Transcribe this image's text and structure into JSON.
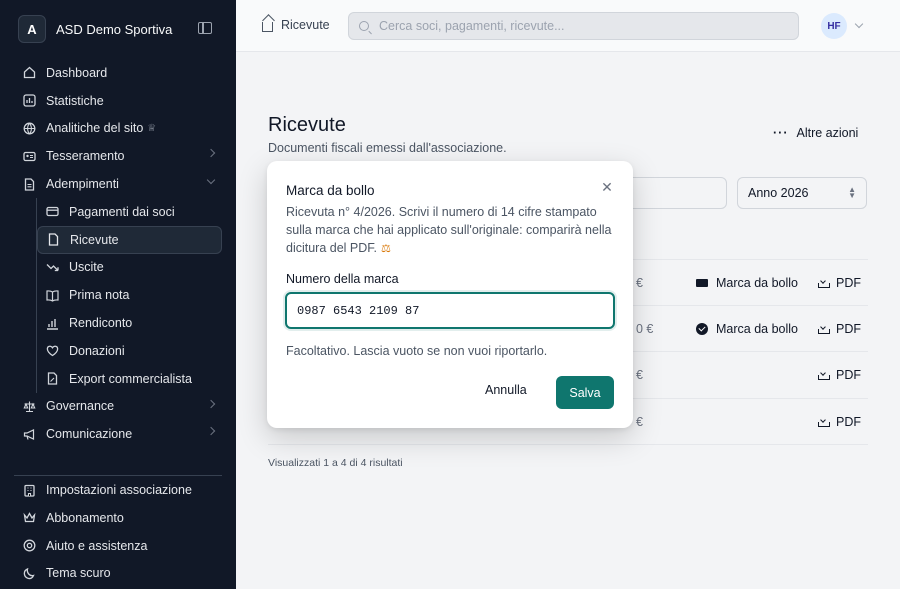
{
  "sidebar": {
    "org_initial": "A",
    "org_name": "ASD Demo Sportiva",
    "items": [
      {
        "label": "Dashboard"
      },
      {
        "label": "Statistiche"
      },
      {
        "label": "Analitiche del sito"
      },
      {
        "label": "Tesseramento"
      },
      {
        "label": "Adempimenti"
      }
    ],
    "sub_items": [
      {
        "label": "Pagamenti dai soci"
      },
      {
        "label": "Ricevute"
      },
      {
        "label": "Uscite"
      },
      {
        "label": "Prima nota"
      },
      {
        "label": "Rendiconto"
      },
      {
        "label": "Donazioni"
      },
      {
        "label": "Export commercialista"
      }
    ],
    "after_items": [
      {
        "label": "Governance"
      },
      {
        "label": "Comunicazione"
      }
    ],
    "bottom_items": [
      {
        "label": "Impostazioni associazione"
      },
      {
        "label": "Abbonamento"
      },
      {
        "label": "Aiuto e assistenza"
      },
      {
        "label": "Tema scuro"
      }
    ]
  },
  "topbar": {
    "breadcrumb": "Ricevute",
    "search_placeholder": "Cerca soci, pagamenti, ricevute...",
    "user_initials": "HF"
  },
  "main": {
    "title": "Ricevute",
    "subtitle": "Documenti fiscali emessi dall'associazione.",
    "more_actions": "Altre azioni",
    "year_select": "Anno 2026",
    "column_fragment": "o",
    "rows": [
      {
        "amount": "€",
        "stamp_label": "Marca da bollo",
        "pdf": "PDF"
      },
      {
        "amount": "0 €",
        "stamp_label": "Marca da bollo",
        "pdf": "PDF"
      },
      {
        "amount": "€",
        "stamp_label": "",
        "pdf": "PDF"
      },
      {
        "amount": "€",
        "stamp_label": "",
        "pdf": "PDF"
      }
    ],
    "results_text": "Visualizzati 1 a 4 di 4 risultati"
  },
  "modal": {
    "title": "Marca da bollo",
    "description": "Ricevuta n° 4/2026. Scrivi il numero di 14 cifre stampato sulla marca che hai applicato sull'originale: comparirà nella dicitura del PDF.",
    "field_label": "Numero della marca",
    "field_value": "0987 6543 2109 87",
    "hint": "Facoltativo. Lascia vuoto se non vuoi riportarlo.",
    "cancel_label": "Annulla",
    "save_label": "Salva"
  },
  "colors": {
    "sidebar_bg": "#111827",
    "accent": "#0f766e"
  }
}
